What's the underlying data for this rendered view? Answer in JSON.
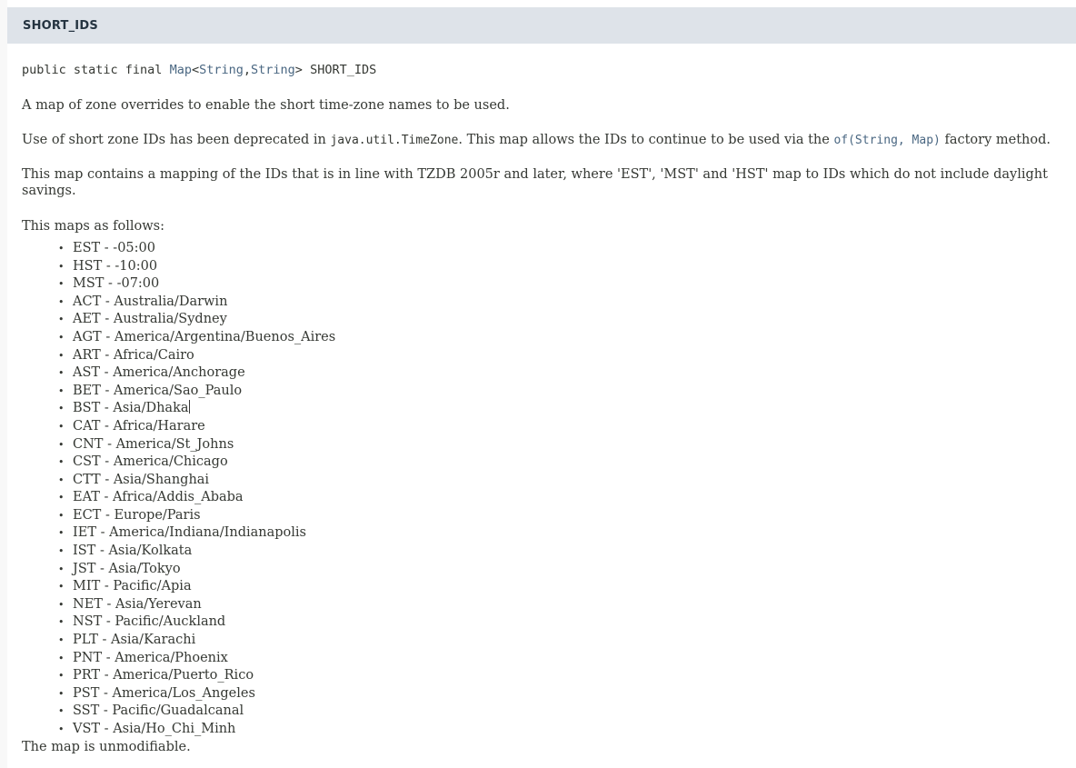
{
  "member": {
    "header_title": "SHORT_IDS",
    "signature": {
      "modifiers": "public static final ",
      "type_open": "Map<",
      "type_link_1": "Map",
      "angle_open": "<",
      "type_link_2": "String",
      "comma": ",",
      "type_link_3": "String",
      "angle_close": "> ",
      "name": "SHORT_IDS"
    },
    "paragraphs": {
      "p1": "A map of zone overrides to enable the short time-zone names to be used.",
      "p2_part1": "Use of short zone IDs has been deprecated in ",
      "p2_code": "java.util.TimeZone",
      "p2_part2": ". This map allows the IDs to continue to be used via the ",
      "p2_link": "of(String, Map)",
      "p2_part3": " factory method.",
      "p3": "This map contains a mapping of the IDs that is in line with TZDB 2005r and later, where 'EST', 'MST' and 'HST' map to IDs which do not include daylight savings.",
      "p4": "This maps as follows:"
    },
    "zone_list": [
      "EST - -05:00",
      "HST - -10:00",
      "MST - -07:00",
      "ACT - Australia/Darwin",
      "AET - Australia/Sydney",
      "AGT - America/Argentina/Buenos_Aires",
      "ART - Africa/Cairo",
      "AST - America/Anchorage",
      "BET - America/Sao_Paulo",
      "BST - Asia/Dhaka",
      "CAT - Africa/Harare",
      "CNT - America/St_Johns",
      "CST - America/Chicago",
      "CTT - Asia/Shanghai",
      "EAT - Africa/Addis_Ababa",
      "ECT - Europe/Paris",
      "IET - America/Indiana/Indianapolis",
      "IST - Asia/Kolkata",
      "JST - Asia/Tokyo",
      "MIT - Pacific/Apia",
      "NET - Asia/Yerevan",
      "NST - Pacific/Auckland",
      "PLT - Asia/Karachi",
      "PNT - America/Phoenix",
      "PRT - America/Puerto_Rico",
      "PST - America/Los_Angeles",
      "SST - Pacific/Guadalcanal",
      "VST - Asia/Ho_Chi_Minh"
    ],
    "caret_after_index": 9,
    "trailer": "The map is unmodifiable."
  },
  "colors": {
    "header_background": "#dee3e9",
    "header_text": "#253441",
    "body_text": "#353833",
    "link": "#4a6782",
    "page_background": "#f8f8f8",
    "content_background": "#ffffff"
  }
}
